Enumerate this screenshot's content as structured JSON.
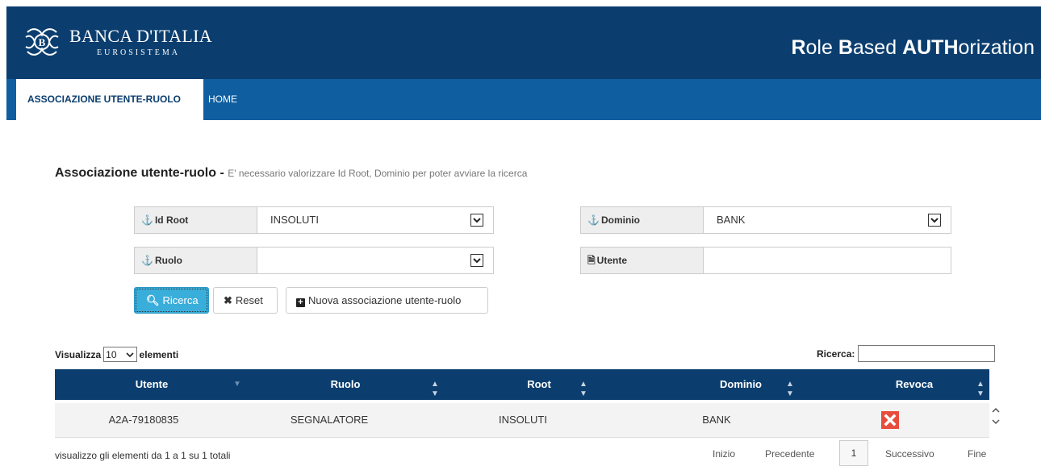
{
  "header": {
    "logo_title": "BANCA D'ITALIA",
    "logo_sub": "EUROSISTEMA",
    "app_title": {
      "p1b": "R",
      "p1": "ole ",
      "p2b": "B",
      "p2": "ased ",
      "p3b": "AUTH",
      "p3": "orization"
    }
  },
  "nav": {
    "tabs": [
      {
        "label": "ASSOCIAZIONE UTENTE-RUOLO"
      },
      {
        "label": "HOME"
      }
    ]
  },
  "page": {
    "title": "Associazione utente-ruolo - ",
    "hint": "E' necessario valorizzare Id Root, Dominio per poter avviare la ricerca"
  },
  "filters": {
    "id_root": {
      "label": "Id Root",
      "value": "INSOLUTI"
    },
    "dominio": {
      "label": "Dominio",
      "value": "BANK"
    },
    "ruolo": {
      "label": "Ruolo",
      "value": ""
    },
    "utente": {
      "label": "Utente",
      "value": ""
    }
  },
  "buttons": {
    "ricerca": "Ricerca",
    "reset": "Reset",
    "nuova": "Nuova associazione utente-ruolo"
  },
  "table_controls": {
    "show_prefix": "Visualizza",
    "page_size": "10",
    "show_suffix": "elementi",
    "search_label": "Ricerca:"
  },
  "table": {
    "columns": [
      "Utente",
      "Ruolo",
      "Root",
      "Dominio",
      "Revoca"
    ],
    "rows": [
      {
        "utente": "A2A-79180835",
        "ruolo": "SEGNALATORE",
        "root": "INSOLUTI",
        "dominio": "BANK"
      }
    ]
  },
  "footer": {
    "info": "visualizzo gli elementi da 1 a 1 su 1 totali",
    "first": "Inizio",
    "prev": "Precedente",
    "current": "1",
    "next": "Successivo",
    "last": "Fine"
  },
  "colors": {
    "header": "#0b3e6f",
    "nav": "#0f5ea0",
    "primary_button": "#3aaedb",
    "revoke": "#e74c3c"
  }
}
